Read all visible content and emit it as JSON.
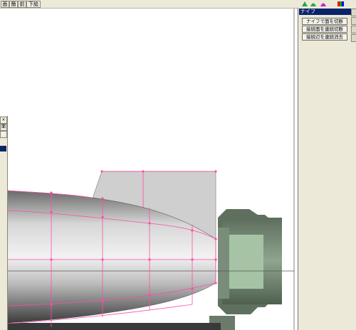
{
  "toolbar": {
    "buttons": [
      "面",
      "簡",
      "前",
      "下絵"
    ]
  },
  "toolbar_icons": [
    "green-triangle-icon",
    "green-mound-icon",
    "magenta-mound-icon",
    "color-swatch-icon"
  ],
  "colors": {
    "panel_bg": "#ece9d8",
    "title_bar": "#0a246a",
    "wireframe": "#ff4da6",
    "hull_light": "#e8e8e8",
    "hull_dark": "#4a4a4a",
    "engine_green": "#9ab79a",
    "engine_dark": "#5c6e5c"
  },
  "knife_panel": {
    "title": "ナイフ",
    "buttons": [
      "ナイフで面を切断",
      "接続面を連続切断",
      "接続辺を連続消去"
    ]
  },
  "left_panel": {
    "close_label": "×",
    "mode_label": "面"
  }
}
